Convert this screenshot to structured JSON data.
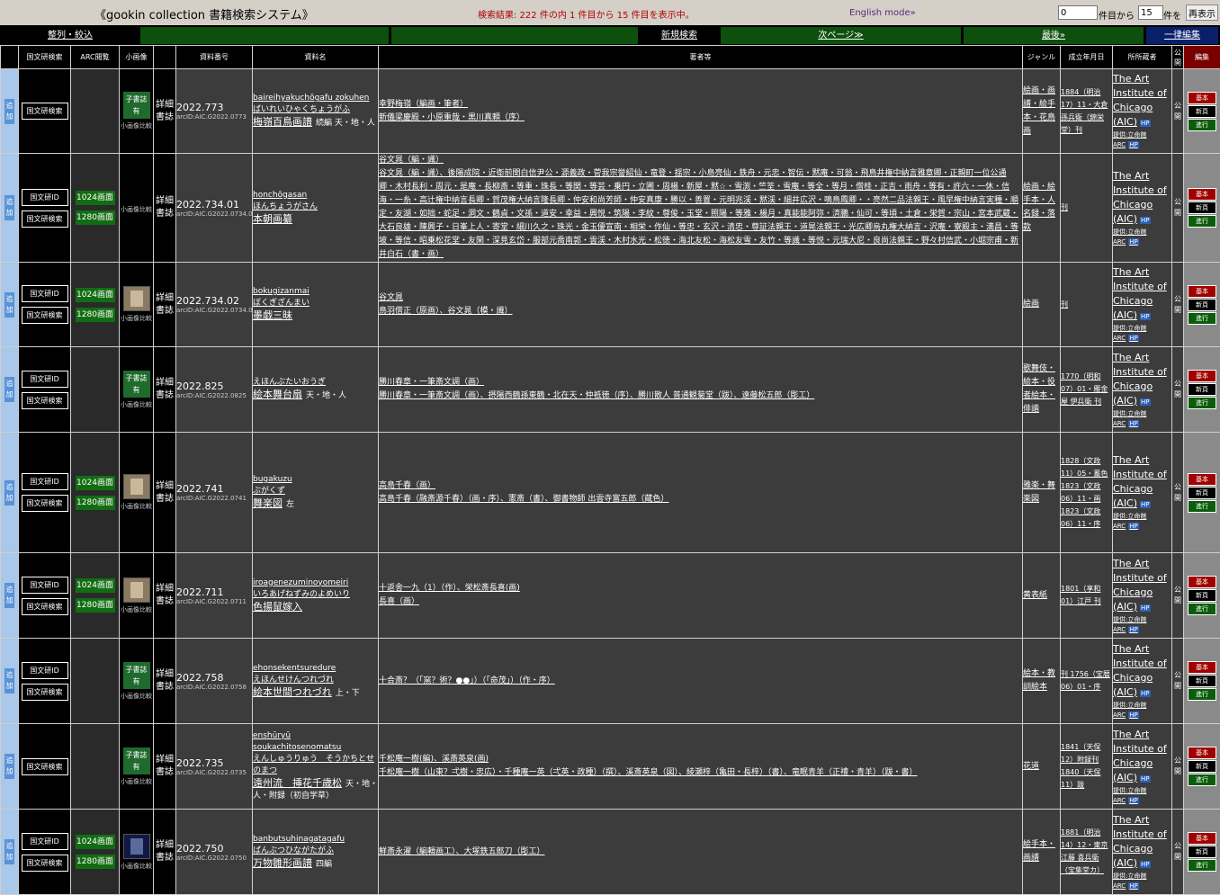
{
  "header": {
    "title": "《gookin collection 書籍検索システム》",
    "result": "検索結果: 222 件の内 1 件目から 15 件目を表示中。",
    "english_mode": "English mode»",
    "start_value": "0",
    "start_suffix": "件目から",
    "count_value": "15",
    "count_suffix": "件を",
    "redisplay": "再表示"
  },
  "nav": {
    "sort": "整列・絞込",
    "new_search": "新規検索",
    "next_page": "次ページ≫",
    "last": "最後»",
    "bulk_edit": "一律編集"
  },
  "columns": {
    "kokubun": "国文研検索",
    "arc": "ARC閲覧",
    "thumb": "小画像",
    "number": "資料番号",
    "name": "資料名",
    "authors": "著者等",
    "genre": "ジャンル",
    "date": "成立年月日",
    "owner": "所所蔵者",
    "public": "公開",
    "edit": "編集"
  },
  "labels": {
    "add": "追加",
    "kokubun_id": "国文研ID",
    "kokubun_search": "国文研検索",
    "arc1024": "1024画面",
    "arc1280": "1280画面",
    "kosho": "子書誌有",
    "compare": "小画像比較",
    "detail": "詳細",
    "biblio": "書誌",
    "hp": "HP",
    "source": "提供:立命館",
    "arc": "ARC",
    "kihon": "基本",
    "shinki": "新頁",
    "shinko": "進行",
    "public_mark": "公開"
  },
  "rows": [
    {
      "number": "2022.773",
      "arc_id": "arcID:AIC.G2022.0773",
      "has_kokubun_id": false,
      "has_arc": false,
      "thumb": "kosho",
      "romaji": "baireihyakuchōgafu zokuhen",
      "kana": "ばいれいひゃくちょうがふ",
      "title": "梅嶺百鳥画譜",
      "subtitle": "続編 天・地・人",
      "authors": [
        "幸野梅嶺（編画・筆者）",
        "新儀梁慶殿・小原重哉・黒川真頼（序）"
      ],
      "genre": "絵画・画譜・絵手本・花鳥画",
      "date": "1884（明治17）11・大倉孫兵衛（錦栄堂）刊",
      "owner": "The Art Institute of Chicago (AIC)"
    },
    {
      "number": "2022.734.01",
      "arc_id": "arcID:AIC.G2022.0734.01",
      "has_kokubun_id": true,
      "has_arc": true,
      "thumb": "none",
      "romaji": "honchōgasan",
      "kana": "ほんちょうがさん",
      "title": "本朝画纂",
      "subtitle": "",
      "authors": [
        "谷文晁（編・識）",
        "谷文晁（編・識）、後陽成院・近衛前関白信尹公・源義政・菅我宗誉紹仙・竜登・揺宗・小島亮仙・鉄舟・元忠・智伝・黙庵・可翁・飛鳥井権中納言雅章卿・正親町一位公通卿・木村長利・周元・是庵・長柳斎・等重・珠長・等関・等芸・乗円・立圃・周楊・新屋・黙☆・雪渕・竺筌・雪庵・等全・等月・僧桂・正吉・雨舟・等有・許六・一休・信海・一糸・高辻権中納言長卿・賀茂権大納言隆長卿・仲安和尚芳師・仲安真康・勝以・善置・元明兆渓・黙渓・細井広沢・鳴鳥鳳卿・・亮然二品法親王・風早権中納言実種・順定・友湖・如拙・蛇足・洞文・鶴貞・文孫・道安・幸益・興悦・筑陽・李紋・尊俊・玉堂・照陽・等雅・楊月・真能能阿弥・済鵬・仙可・等頃・土倉・栄賀・宗山・宮本武蔵・大石良雄・陳興子・日峯上人・寄堂・細川久之・珠光・金玉優宣南・相栄・作仙・等忠・玄沢・清忠・尊証法親王・道晃法親王・光広卿烏丸権大納言・沢庵・寮殿主・満昌・等坡・等信・昭乗松花堂・友閑・深見玄岱・服部元喬南郭・雲渓・木村水光・松徳・海北友松・海松友雪・友竹・等識・等悦・元瑞大尼・良尚法親王・野々村信武・小堀宗甫・新井白石（書・画）"
      ],
      "genre": "絵画・絵手本・人名録・落款",
      "date": "刊",
      "owner": "The Art Institute of Chicago (AIC)"
    },
    {
      "number": "2022.734.02",
      "arc_id": "arcID:AIC.G2022.0734.02",
      "has_kokubun_id": true,
      "has_arc": true,
      "thumb": "pic",
      "romaji": "bokugizanmai",
      "kana": "ぼくぎざんまい",
      "title": "墨戯三昧",
      "subtitle": "",
      "authors": [
        "谷文晁",
        "鳥羽僧正（原画）、谷文晁（模・識）"
      ],
      "genre": "絵画",
      "date": "刊",
      "owner": "The Art Institute of Chicago (AIC)"
    },
    {
      "number": "2022.825",
      "arc_id": "arcID:AIC.G2022.0825",
      "has_kokubun_id": true,
      "has_arc": false,
      "thumb": "kosho",
      "romaji": "",
      "kana": "えほんぶたいおうぎ",
      "title": "絵本舞台扇",
      "subtitle": "天・地・人",
      "authors": [
        "勝川春章・一筆斎文調（画）",
        "勝川春章・一筆斎文調（画）、摂陽西鶴孫東鶴・北在天・仲祇徳（序）、勝川散人 普通観菊堂（跋）、遠藤松五郎（彫工）"
      ],
      "genre": "歌舞伎・絵本・役者絵本・俳諧",
      "date": "1770（明和07）01・雁金屋 伊兵衛 刊",
      "owner": "The Art Institute of Chicago (AIC)"
    },
    {
      "number": "2022.741",
      "arc_id": "arcID:AIC.G2022.0741",
      "has_kokubun_id": true,
      "has_arc": true,
      "thumb": "pic",
      "romaji": "bugakuzu",
      "kana": "ぶがくず",
      "title": "舞楽図",
      "subtitle": "左",
      "authors": [
        "高島千春（画）",
        "高島千春（融斎源千春）（画・序）、憲斎（書）、御書物師 出雲寺富五郎（蔵色）"
      ],
      "genre": "雅楽・舞楽図",
      "date": "1828（文政11）05・蓄色 1823（文政06）11・画 1823（文政06）11・序",
      "owner": "The Art Institute of Chicago (AIC)"
    },
    {
      "number": "2022.711",
      "arc_id": "arcID:AIC.G2022.0711",
      "has_kokubun_id": true,
      "has_arc": true,
      "thumb": "pic",
      "romaji": "iroagenezuminoyomeiri",
      "kana": "いろあげねずみのよめいり",
      "title": "色揚鼠嫁入",
      "subtitle": "",
      "authors": [
        "十返舎一九（1）（作）、栄松斎長喜(画)",
        "長喜（画）"
      ],
      "genre": "黄表紙",
      "date": "1801（享和01）江戸 刊",
      "owner": "The Art Institute of Chicago (AIC)"
    },
    {
      "number": "2022.758",
      "arc_id": "arcID:AIC.G2022.0758",
      "has_kokubun_id": true,
      "has_arc": false,
      "thumb": "kosho",
      "romaji": "ehonsekentsuredure",
      "kana": "えほんせけんつれづれ",
      "title": "絵本世間つれづれ",
      "subtitle": "上・下",
      "authors": [
        "十合斎？（「窯？術？●●」）（「命茂」）（作・序）"
      ],
      "genre": "絵本・教訓絵本",
      "date": "刊 1756（宝暦06）01・序",
      "owner": "The Art Institute of Chicago (AIC)"
    },
    {
      "number": "2022.735",
      "arc_id": "arcID:AIC.G2022.0735",
      "has_kokubun_id": false,
      "has_arc": false,
      "thumb": "kosho",
      "romaji": "enshūryū soukachitosenomatsu",
      "kana": "えんしゅうりゅう　そうかちとせのまつ",
      "title": "遠州流　挿花千歳松",
      "subtitle": "天・地・人・附録（初自学草）",
      "authors": [
        "千松庵一樹(編)、溪斎英泉(画)",
        "千松庵一樹（山東？弌樹・忠広）・千種庵一英（弌英・政種）（撰）、溪斎英泉（図）、綾瀬梓（亀田・長梓）（書）、竜眠青羊（正禮・青羊）（跋・書）"
      ],
      "genre": "花道",
      "date": "1841（天保12）附録刊 1840（天保11）跋",
      "owner": "The Art Institute of Chicago (AIC)"
    },
    {
      "number": "2022.750",
      "arc_id": "arcID:AIC.G2022.0750",
      "has_kokubun_id": true,
      "has_arc": true,
      "thumb": "navy",
      "romaji": "banbutsuhinagatagafu",
      "kana": "ばんぶつひながたがふ",
      "title": "万物雛形画譜",
      "subtitle": "四編",
      "authors": [
        "鮮斎永濯（編輯画工）、大塚鉄五郎刀（彫工）"
      ],
      "genre": "絵手本・画譜",
      "date": "1881（明治14）12・東京江藤 喜兵衛（宝集堂カ）",
      "owner": "The Art Institute of Chicago (AIC)"
    }
  ]
}
